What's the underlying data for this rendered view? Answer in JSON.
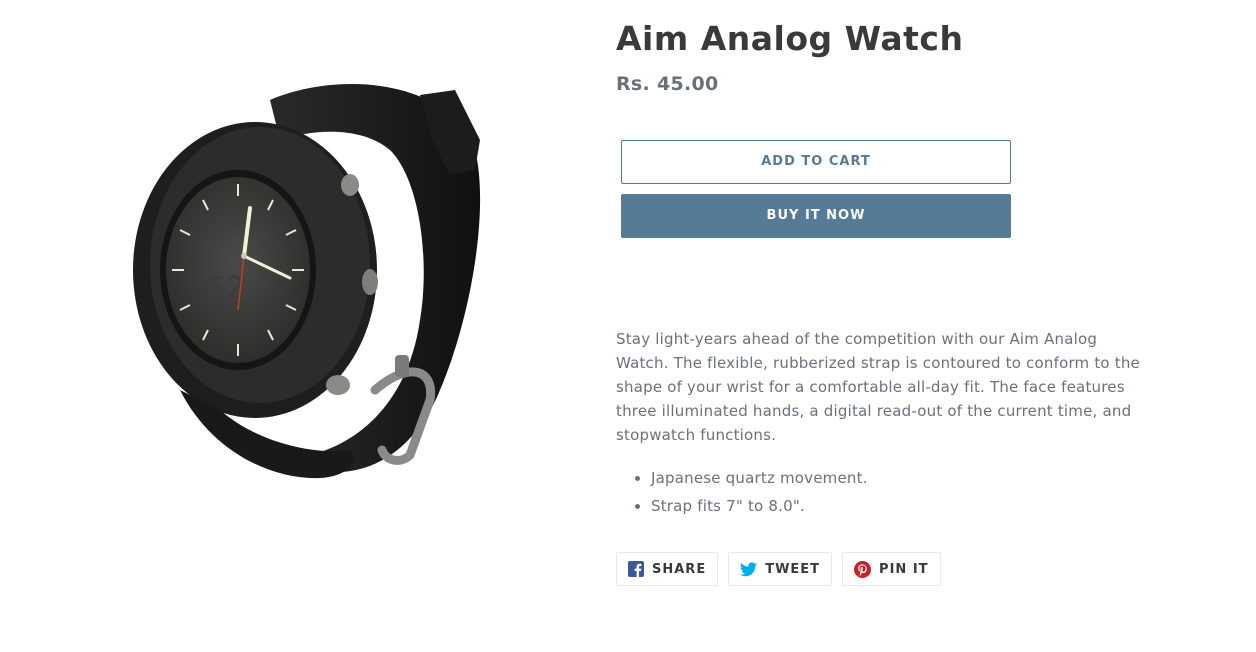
{
  "product": {
    "title": "Aim Analog Watch",
    "price": "Rs. 45.00",
    "image_alt": "Aim Analog Watch"
  },
  "actions": {
    "add_to_cart": "ADD TO CART",
    "buy_now": "BUY IT NOW"
  },
  "description": {
    "paragraph": "Stay light-years ahead of the competition with our Aim Analog Watch. The flexible, rubberized strap is contoured to conform to the shape of your wrist for a comfortable all-day fit. The face features three illuminated hands, a digital read-out of the current time, and stopwatch functions.",
    "bullets": [
      "Japanese quartz movement.",
      "Strap fits 7\" to 8.0\"."
    ]
  },
  "social": {
    "share": "SHARE",
    "tweet": "TWEET",
    "pin": "PIN IT",
    "icons": [
      "facebook-icon",
      "twitter-icon",
      "pinterest-icon"
    ]
  },
  "colors": {
    "accent": "#557b97",
    "title": "#3a3a3a",
    "text": "#69727b",
    "facebook": "#3b5998",
    "twitter": "#00aced",
    "pinterest": "#cb2027"
  }
}
